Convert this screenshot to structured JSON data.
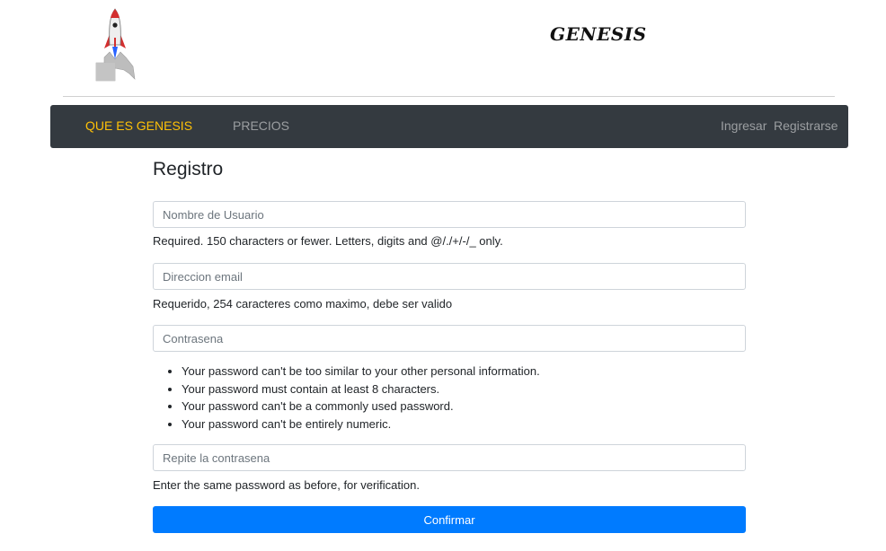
{
  "header": {
    "logo_icon": "rocket-icon",
    "brand": "GENESIS"
  },
  "nav": {
    "left_items": [
      {
        "label": "QUE ES GENESIS",
        "active": true
      },
      {
        "label": "PRECIOS",
        "active": false
      }
    ],
    "right_items": [
      {
        "label": "Ingresar"
      },
      {
        "label": "Registrarse"
      }
    ],
    "background": "#343a40",
    "active_color": "#ffc107"
  },
  "form": {
    "title": "Registro",
    "username": {
      "placeholder": "Nombre de Usuario",
      "value": "",
      "help": "Required. 150 characters or fewer. Letters, digits and @/./+/-/_ only."
    },
    "email": {
      "placeholder": "Direccion email",
      "value": "",
      "help": "Requerido, 254 caracteres como maximo, debe ser valido"
    },
    "password": {
      "placeholder": "Contrasena",
      "value": "",
      "rules": [
        "Your password can't be too similar to your other personal information.",
        "Your password must contain at least 8 characters.",
        "Your password can't be a commonly used password.",
        "Your password can't be entirely numeric."
      ]
    },
    "password_confirm": {
      "placeholder": "Repite la contrasena",
      "value": "",
      "help": "Enter the same password as before, for verification."
    },
    "submit_label": "Confirmar",
    "submit_color": "#007bff"
  }
}
